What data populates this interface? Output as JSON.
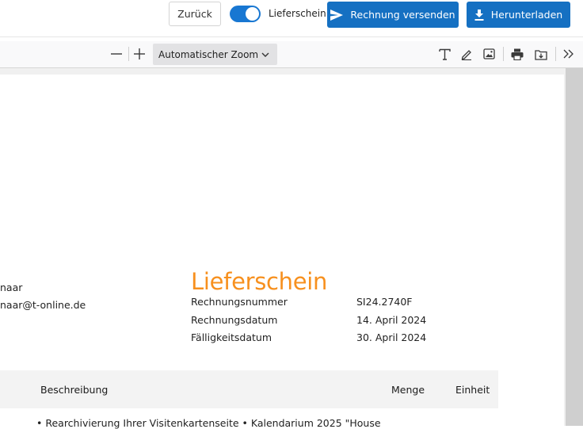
{
  "topbar": {
    "back_label": "Zurück",
    "toggle_label": "Lieferschein",
    "toggle_on": true,
    "send_label": "Rechnung versenden",
    "download_label": "Herunterladen",
    "accent_color": "#1570c2"
  },
  "pdf_toolbar": {
    "zoom_value": "Automatischer Zoom",
    "icons": [
      "zoom-out-icon",
      "zoom-in-icon",
      "chevron-down-icon",
      "text-tool-icon",
      "draw-tool-icon",
      "image-tool-icon",
      "print-icon",
      "save-icon",
      "more-tools-icon"
    ]
  },
  "document": {
    "title": "Lieferschein",
    "title_color": "#f7901e",
    "address_lines": [
      "naar",
      "naar@t-online.de"
    ],
    "meta": [
      {
        "label": "Rechnungsnummer",
        "value": "SI24.2740F"
      },
      {
        "label": "Rechnungsdatum",
        "value": "14. April 2024"
      },
      {
        "label": "Fälligkeitsdatum",
        "value": "30. April 2024"
      }
    ],
    "table": {
      "headers": [
        "Beschreibung",
        "Menge",
        "Einheit"
      ],
      "rows": [
        {
          "description": "• Rearchivierung Ihrer Visitenkartenseite • Kalendarium 2025 \"House"
        }
      ]
    }
  }
}
